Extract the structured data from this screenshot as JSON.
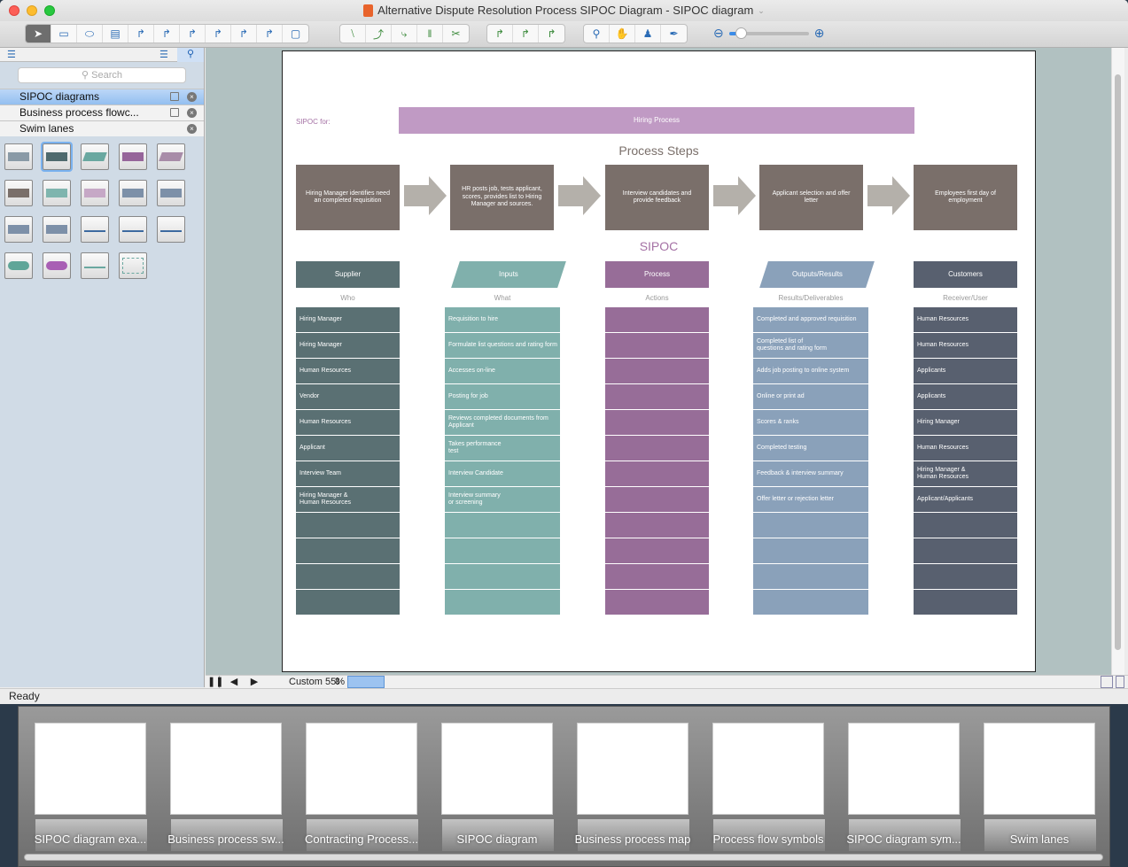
{
  "window": {
    "title": "Alternative Dispute Resolution Process SIPOC Diagram - SIPOC diagram"
  },
  "toolbar": {
    "groups": [
      [
        "pointer-tool",
        "rectangle-tool",
        "ellipse-tool",
        "text-tool",
        "connector-1",
        "connector-2",
        "connector-3",
        "connector-4",
        "connector-5",
        "connector-6",
        "insert-tool"
      ],
      [
        "line-tool",
        "arc-tool",
        "bezier-tool",
        "split-tool",
        "cut-tool"
      ],
      [
        "snap-1",
        "snap-2",
        "snap-3"
      ],
      [
        "zoom-tool",
        "pan-tool",
        "stamp-tool",
        "eyedropper-tool"
      ]
    ],
    "zoom_fraction": 0.15
  },
  "left_panel": {
    "search_placeholder": "Search",
    "libraries": [
      {
        "label": "SIPOC diagrams",
        "active": true,
        "savable": true
      },
      {
        "label": "Business process flowc...",
        "active": false,
        "savable": true
      },
      {
        "label": "Swim lanes",
        "active": false,
        "savable": false
      }
    ],
    "shapes": [
      {
        "name": "sipoc-table",
        "color": "#8a9aa6"
      },
      {
        "name": "rectangle-dark-teal",
        "color": "#4f6a6e"
      },
      {
        "name": "parallelogram-teal",
        "color": "#6aa8a0"
      },
      {
        "name": "rectangle-purple",
        "color": "#96659a"
      },
      {
        "name": "parallelogram-lilac",
        "color": "#a88ca8"
      },
      {
        "name": "rectangle-brown",
        "color": "#7a6f6a"
      },
      {
        "name": "document-teal",
        "color": "#7fb5ae"
      },
      {
        "name": "document-lilac",
        "color": "#c6a8c6"
      },
      {
        "name": "arrow-right",
        "color": "#7d90a8"
      },
      {
        "name": "arrow-left",
        "color": "#7d90a8"
      },
      {
        "name": "arrow-up",
        "color": "#7d90a8"
      },
      {
        "name": "arrow-down",
        "color": "#7d90a8"
      },
      {
        "name": "step-connector-1",
        "color": "#3d6aa0"
      },
      {
        "name": "step-connector-2",
        "color": "#3d6aa0"
      },
      {
        "name": "diagonal-arrow",
        "color": "#3d6aa0"
      },
      {
        "name": "terminator-teal",
        "color": "#5fa598"
      },
      {
        "name": "terminator-purple",
        "color": "#a85fb4"
      },
      {
        "name": "brace",
        "color": "#6aa8a0"
      },
      {
        "name": "dashed-container",
        "color": "#6aa8a0"
      }
    ]
  },
  "diagram": {
    "sipoc_for_label": "SIPOC for:",
    "process_name": "Hiring Process",
    "process_steps_heading": "Process Steps",
    "steps": [
      "Hiring Manager identifies need an completed requisition",
      "HR posts job, tests applicant, scores, provides list to Hiring Manager and sources.",
      "Interview candidates and provide feedback",
      "Applicant selection and offer letter",
      "Employees first day of employment"
    ],
    "sipoc_heading": "SIPOC",
    "columns": [
      {
        "header": "Supplier",
        "subheader": "Who",
        "color": "#5a7073",
        "header_color": "#5a7073",
        "cells": [
          "Hiring Manager",
          "Hiring Manager",
          "Human Resources",
          "Vendor",
          "Human Resources",
          "Applicant",
          "Interview Team",
          "Hiring Manager &\nHuman Resources",
          "",
          "",
          "",
          ""
        ]
      },
      {
        "header": "Inputs",
        "subheader": "What",
        "color": "#80b0ac",
        "header_color": "#80b0ac",
        "cells": [
          "Requisition to hire",
          "Formulate list questions and rating form",
          "Accesses on-line",
          "Posting for job",
          "Reviews completed documents from Applicant",
          "Takes performance\ntest",
          "Interview Candidate",
          "Interview summary\nor screening",
          "",
          "",
          "",
          ""
        ]
      },
      {
        "header": "Process",
        "subheader": "Actions",
        "color": "#976d98",
        "header_color": "#976d98",
        "cells": [
          "",
          "",
          "",
          "",
          "",
          "",
          "",
          "",
          "",
          "",
          "",
          ""
        ]
      },
      {
        "header": "Outputs/Results",
        "subheader": "Results/Deliverables",
        "color": "#8aa1ba",
        "header_color": "#8aa1ba",
        "cells": [
          "Completed and approved requisition",
          "Completed list of\nquestions and rating form",
          "Adds job posting to online system",
          "Online or print ad",
          "Scores & ranks",
          "Completed testing",
          "Feedback & interview summary",
          "Offer letter or rejection letter",
          "",
          "",
          "",
          ""
        ]
      },
      {
        "header": "Customers",
        "subheader": "Receiver/User",
        "color": "#58606f",
        "header_color": "#58606f",
        "cells": [
          "Human Resources",
          "Human Resources",
          "Applicants",
          "Applicants",
          "Hiring Manager",
          "Human Resources",
          "Hiring Manager &\nHuman Resources",
          "Applicant/Applicants",
          "",
          "",
          "",
          ""
        ]
      }
    ]
  },
  "bottom_bar": {
    "zoom_label": "Custom 55%"
  },
  "status": {
    "text": "Ready"
  },
  "thumbnails": [
    {
      "label": "SIPOC diagram exa..."
    },
    {
      "label": "Business process sw..."
    },
    {
      "label": "Contracting Process..."
    },
    {
      "label": "SIPOC diagram"
    },
    {
      "label": "Business process map"
    },
    {
      "label": "Process flow symbols"
    },
    {
      "label": "SIPOC diagram sym..."
    },
    {
      "label": "Swim lanes"
    }
  ]
}
